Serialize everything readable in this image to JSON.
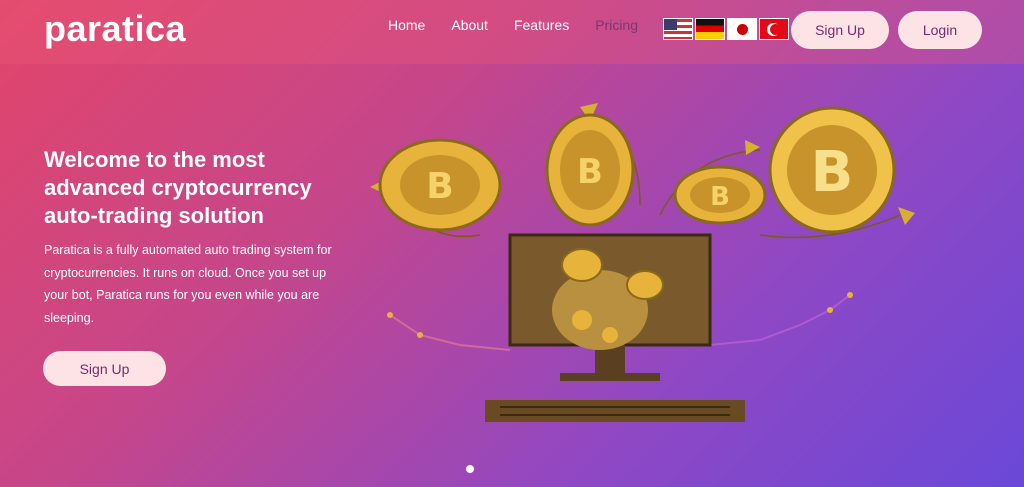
{
  "brand": {
    "logo": "paratica"
  },
  "nav": {
    "items": [
      "Home",
      "About",
      "Features",
      "Pricing"
    ]
  },
  "languages": [
    {
      "icon": "us-flag-icon"
    },
    {
      "icon": "germany-flag-icon"
    },
    {
      "icon": "japan-flag-icon"
    },
    {
      "icon": "turkey-flag-icon"
    }
  ],
  "header": {
    "signup_label": "Sign Up",
    "login_label": "Login"
  },
  "hero": {
    "title": "Welcome to the most advanced cryptocurrency auto-trading solution",
    "description": "Paratica is a fully automated auto trading system for cryptocurrencies. It runs on cloud. Once you set up your bot, Paratica runs for you even while you are sleeping.",
    "signup_label": "Sign Up",
    "illustration": "crypto-trading-illustration"
  },
  "colors": {
    "gradient_start": "#e2456a",
    "gradient_end": "#6a48d8",
    "button_bg": "#fde3e6",
    "button_text": "#7a2a6a",
    "coin_gold": "#e8b33a"
  }
}
